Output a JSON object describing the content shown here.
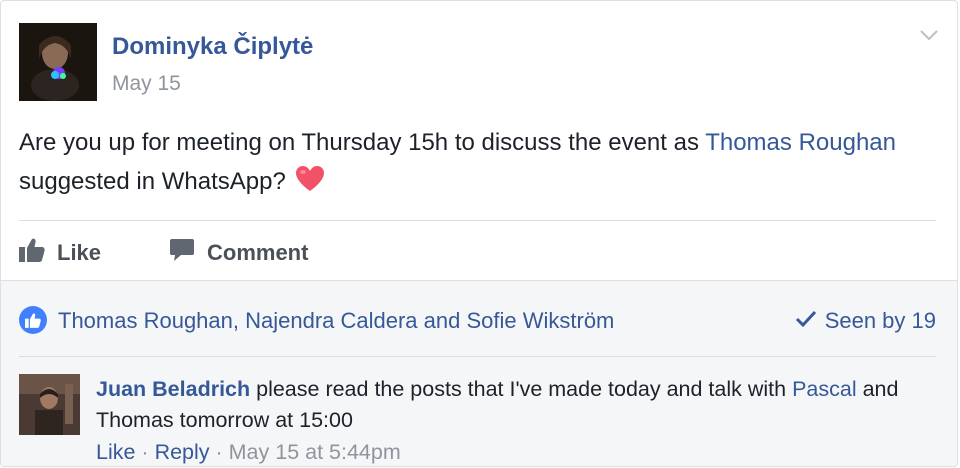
{
  "post": {
    "author": "Dominyka Čiplytė",
    "date": "May 15",
    "text_before": "Are you up for meeting on Thursday 15h to discuss the event as ",
    "mention": "Thomas Roughan",
    "text_after": " suggested in WhatsApp?",
    "emoji": "heart-icon"
  },
  "actions": {
    "like": "Like",
    "comment": "Comment"
  },
  "reactions": {
    "names": "Thomas Roughan, Najendra Caldera and Sofie Wikström",
    "seen": "Seen by 19"
  },
  "comment": {
    "author": "Juan Beladrich",
    "text_before": " please read the posts that I've made today and talk with ",
    "mention": "Pascal",
    "text_after": " and Thomas tomorrow at 15:00",
    "like": "Like",
    "dot1": " · ",
    "reply": "Reply",
    "dot2": " · ",
    "timestamp": "May 15 at 5:44pm"
  },
  "colors": {
    "link": "#365899",
    "muted": "#90949c",
    "like_badge": "#4080ff",
    "heart": "#f25268"
  }
}
